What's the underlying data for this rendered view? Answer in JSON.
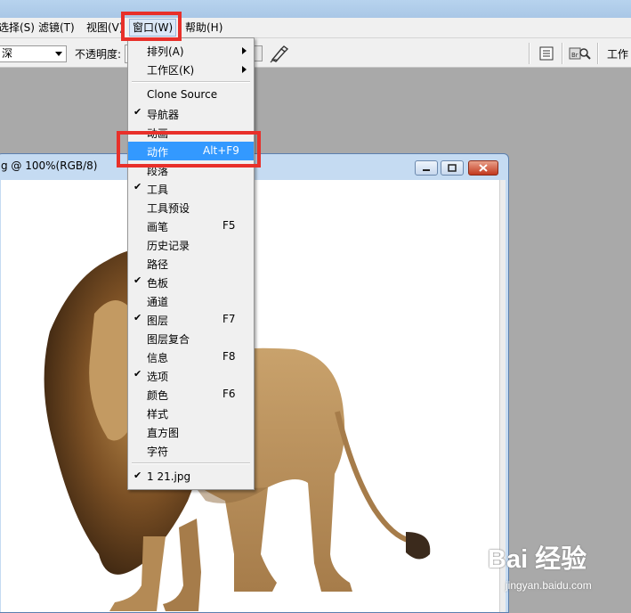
{
  "menubar": {
    "items": [
      "选择(S)",
      "滤镜(T)",
      "视图(V)",
      "窗口(W)",
      "帮助(H)"
    ]
  },
  "optionsbar": {
    "mode_value": "深",
    "opacity_label": "不透明度:",
    "workspace_label": "工作"
  },
  "document": {
    "title": "g @ 100%(RGB/8)"
  },
  "window_menu": {
    "items": [
      {
        "label": "排列(A)",
        "shortcut": "",
        "checked": false,
        "submenu": true
      },
      {
        "label": "工作区(K)",
        "shortcut": "",
        "checked": false,
        "submenu": true
      },
      {
        "label": "Clone Source",
        "shortcut": "",
        "checked": false
      },
      {
        "label": "导航器",
        "shortcut": "",
        "checked": true
      },
      {
        "label": "动画",
        "shortcut": "",
        "checked": false
      },
      {
        "label": "动作",
        "shortcut": "Alt+F9",
        "checked": false,
        "highlighted": true
      },
      {
        "label": "段落",
        "shortcut": "",
        "checked": false
      },
      {
        "label": "工具",
        "shortcut": "",
        "checked": true
      },
      {
        "label": "工具预设",
        "shortcut": "",
        "checked": false
      },
      {
        "label": "画笔",
        "shortcut": "F5",
        "checked": false
      },
      {
        "label": "历史记录",
        "shortcut": "",
        "checked": false
      },
      {
        "label": "路径",
        "shortcut": "",
        "checked": false
      },
      {
        "label": "色板",
        "shortcut": "",
        "checked": true
      },
      {
        "label": "通道",
        "shortcut": "",
        "checked": false
      },
      {
        "label": "图层",
        "shortcut": "F7",
        "checked": true
      },
      {
        "label": "图层复合",
        "shortcut": "",
        "checked": false
      },
      {
        "label": "信息",
        "shortcut": "F8",
        "checked": false
      },
      {
        "label": "选项",
        "shortcut": "",
        "checked": true
      },
      {
        "label": "颜色",
        "shortcut": "F6",
        "checked": false
      },
      {
        "label": "样式",
        "shortcut": "",
        "checked": false
      },
      {
        "label": "直方图",
        "shortcut": "",
        "checked": false
      },
      {
        "label": "字符",
        "shortcut": "",
        "checked": false
      },
      {
        "label": "1 21.jpg",
        "shortcut": "",
        "checked": true
      }
    ]
  },
  "watermark": {
    "logo": "Bai 经验",
    "url": "jingyan.baidu.com"
  },
  "colors": {
    "highlight_red": "#e8302a",
    "menu_highlight": "#3399ff",
    "workspace_bg": "#a9a9a9"
  }
}
